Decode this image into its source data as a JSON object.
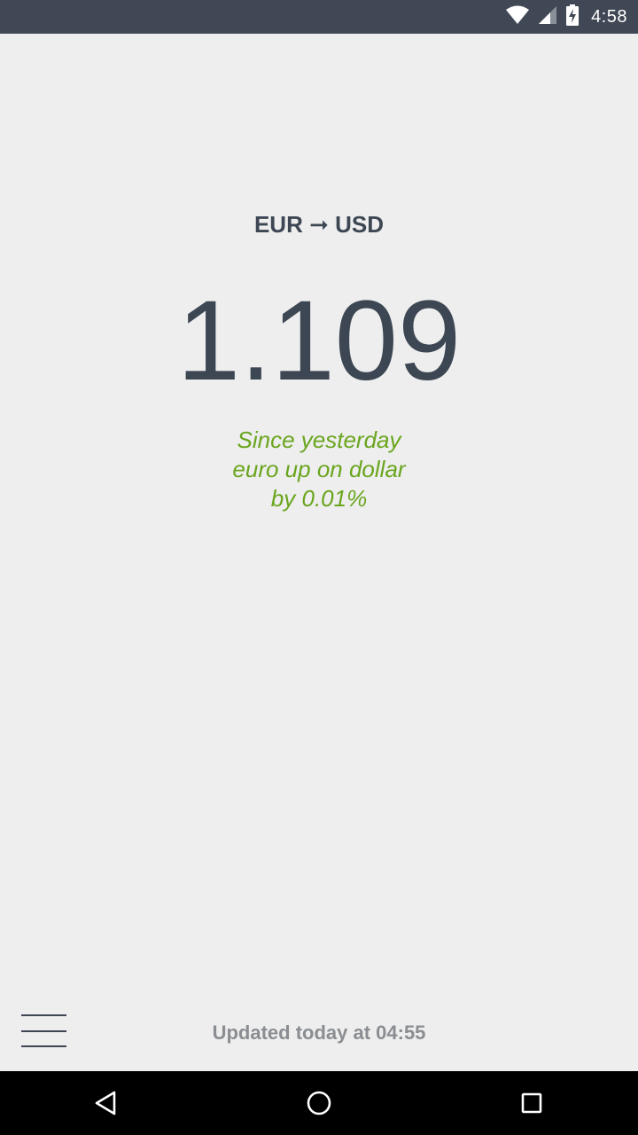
{
  "status_bar": {
    "time": "4:58",
    "icons": [
      "wifi-icon",
      "cellular-signal-icon",
      "battery-charging-icon"
    ]
  },
  "rate": {
    "from": "EUR",
    "arrow": "➞",
    "to": "USD",
    "value": "1.109"
  },
  "change": {
    "line1": "Since yesterday",
    "line2": "euro up on dollar",
    "line3": "by 0.01%"
  },
  "footer": {
    "updated": "Updated today at 04:55",
    "menu_icon": "hamburger-menu-icon"
  },
  "nav_bar": {
    "icons": [
      "back-icon",
      "home-icon",
      "recents-icon"
    ]
  },
  "colors": {
    "status_bar": "#404855",
    "background": "#eeeeee",
    "primary_text": "#3d4653",
    "positive": "#6aa51e",
    "muted": "#8a8d91"
  }
}
